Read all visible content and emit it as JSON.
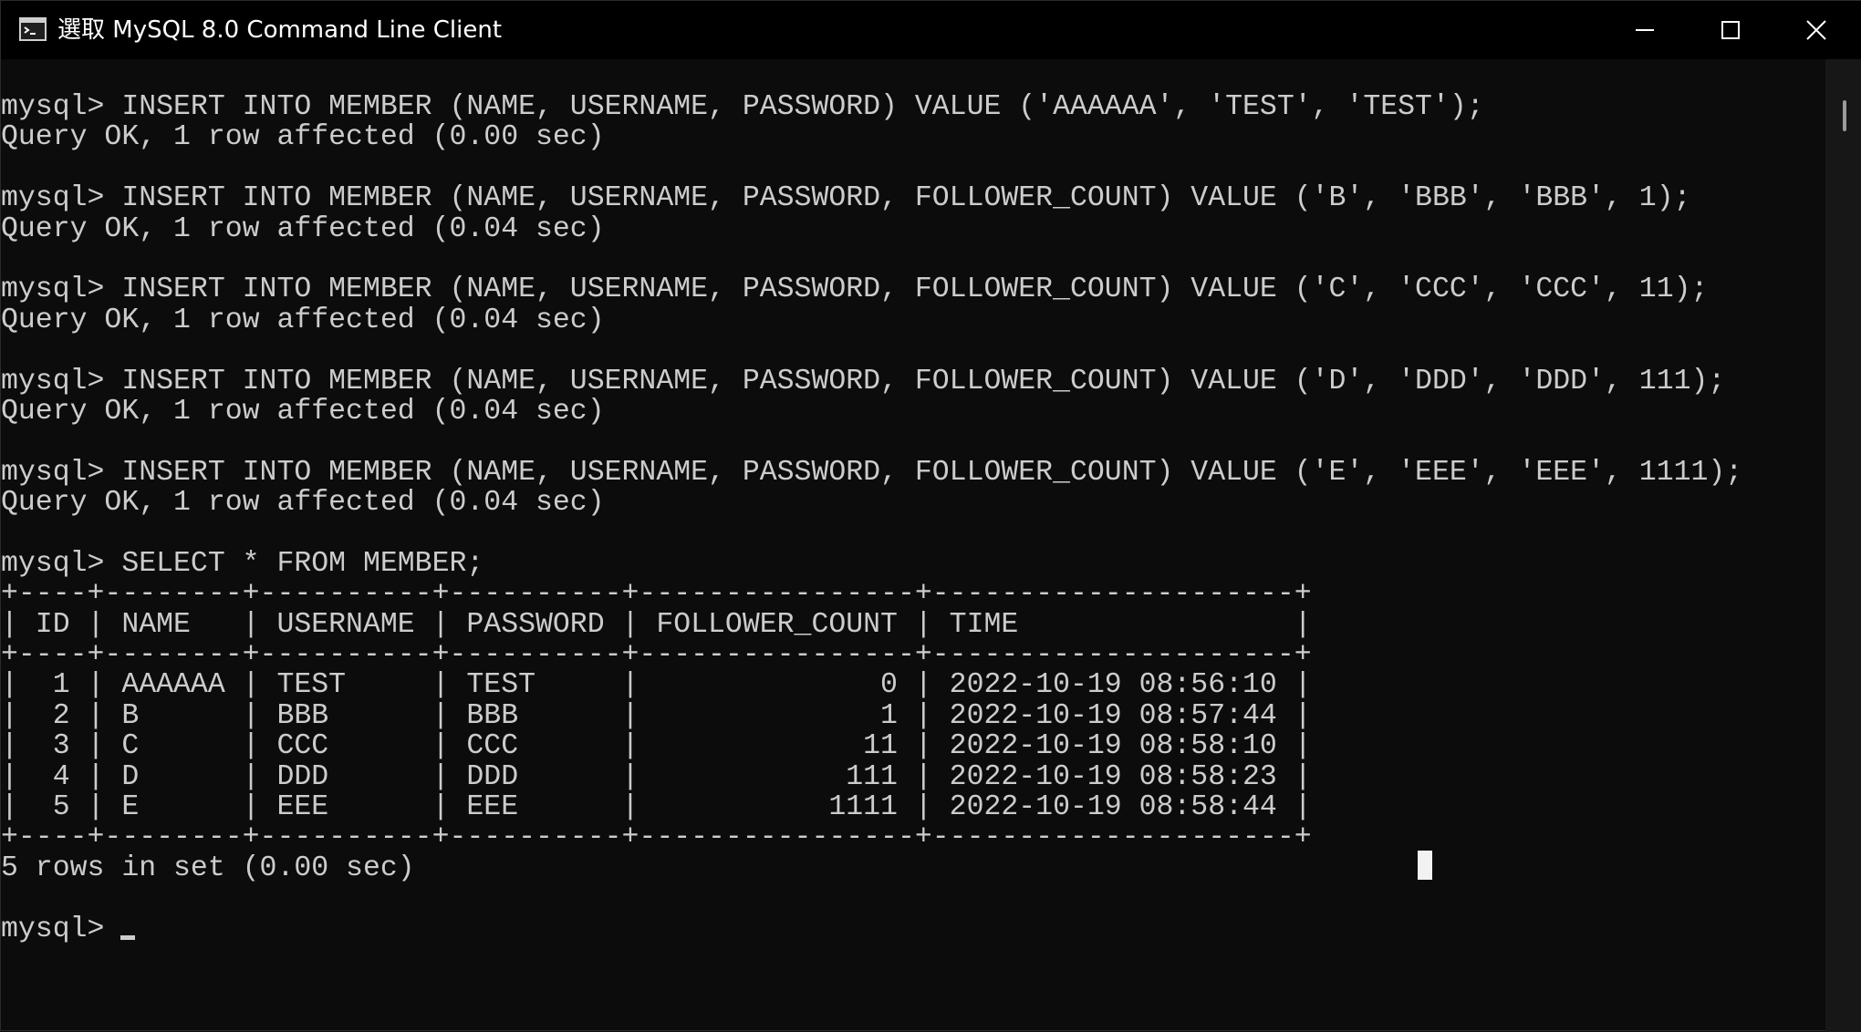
{
  "window": {
    "title": "選取 MySQL 8.0 Command Line Client",
    "icon": "cmd-icon"
  },
  "controls": {
    "minimize": "minimize-icon",
    "maximize": "maximize-icon",
    "close": "close-icon"
  },
  "terminal": {
    "lines": [
      "mysql> INSERT INTO MEMBER (NAME, USERNAME, PASSWORD) VALUE ('AAAAAA', 'TEST', 'TEST');",
      "Query OK, 1 row affected (0.00 sec)",
      "",
      "mysql> INSERT INTO MEMBER (NAME, USERNAME, PASSWORD, FOLLOWER_COUNT) VALUE ('B', 'BBB', 'BBB', 1);",
      "Query OK, 1 row affected (0.04 sec)",
      "",
      "mysql> INSERT INTO MEMBER (NAME, USERNAME, PASSWORD, FOLLOWER_COUNT) VALUE ('C', 'CCC', 'CCC', 11);",
      "Query OK, 1 row affected (0.04 sec)",
      "",
      "mysql> INSERT INTO MEMBER (NAME, USERNAME, PASSWORD, FOLLOWER_COUNT) VALUE ('D', 'DDD', 'DDD', 111);",
      "Query OK, 1 row affected (0.04 sec)",
      "",
      "mysql> INSERT INTO MEMBER (NAME, USERNAME, PASSWORD, FOLLOWER_COUNT) VALUE ('E', 'EEE', 'EEE', 1111);",
      "Query OK, 1 row affected (0.04 sec)",
      "",
      "mysql> SELECT * FROM MEMBER;",
      "+----+--------+----------+----------+----------------+---------------------+",
      "| ID | NAME   | USERNAME | PASSWORD | FOLLOWER_COUNT | TIME                |",
      "+----+--------+----------+----------+----------------+---------------------+",
      "|  1 | AAAAAA | TEST     | TEST     |              0 | 2022-10-19 08:56:10 |",
      "|  2 | B      | BBB      | BBB      |              1 | 2022-10-19 08:57:44 |",
      "|  3 | C      | CCC      | CCC      |             11 | 2022-10-19 08:58:10 |",
      "|  4 | D      | DDD      | DDD      |            111 | 2022-10-19 08:58:23 |",
      "|  5 | E      | EEE      | EEE      |           1111 | 2022-10-19 08:58:44 |",
      "+----+--------+----------+----------+----------------+---------------------+",
      "5 rows in set (0.00 sec)",
      ""
    ],
    "prompt": "mysql>"
  },
  "colors": {
    "background": "#0c0c0c",
    "text": "#cccccc",
    "titlebar": "#000000"
  }
}
